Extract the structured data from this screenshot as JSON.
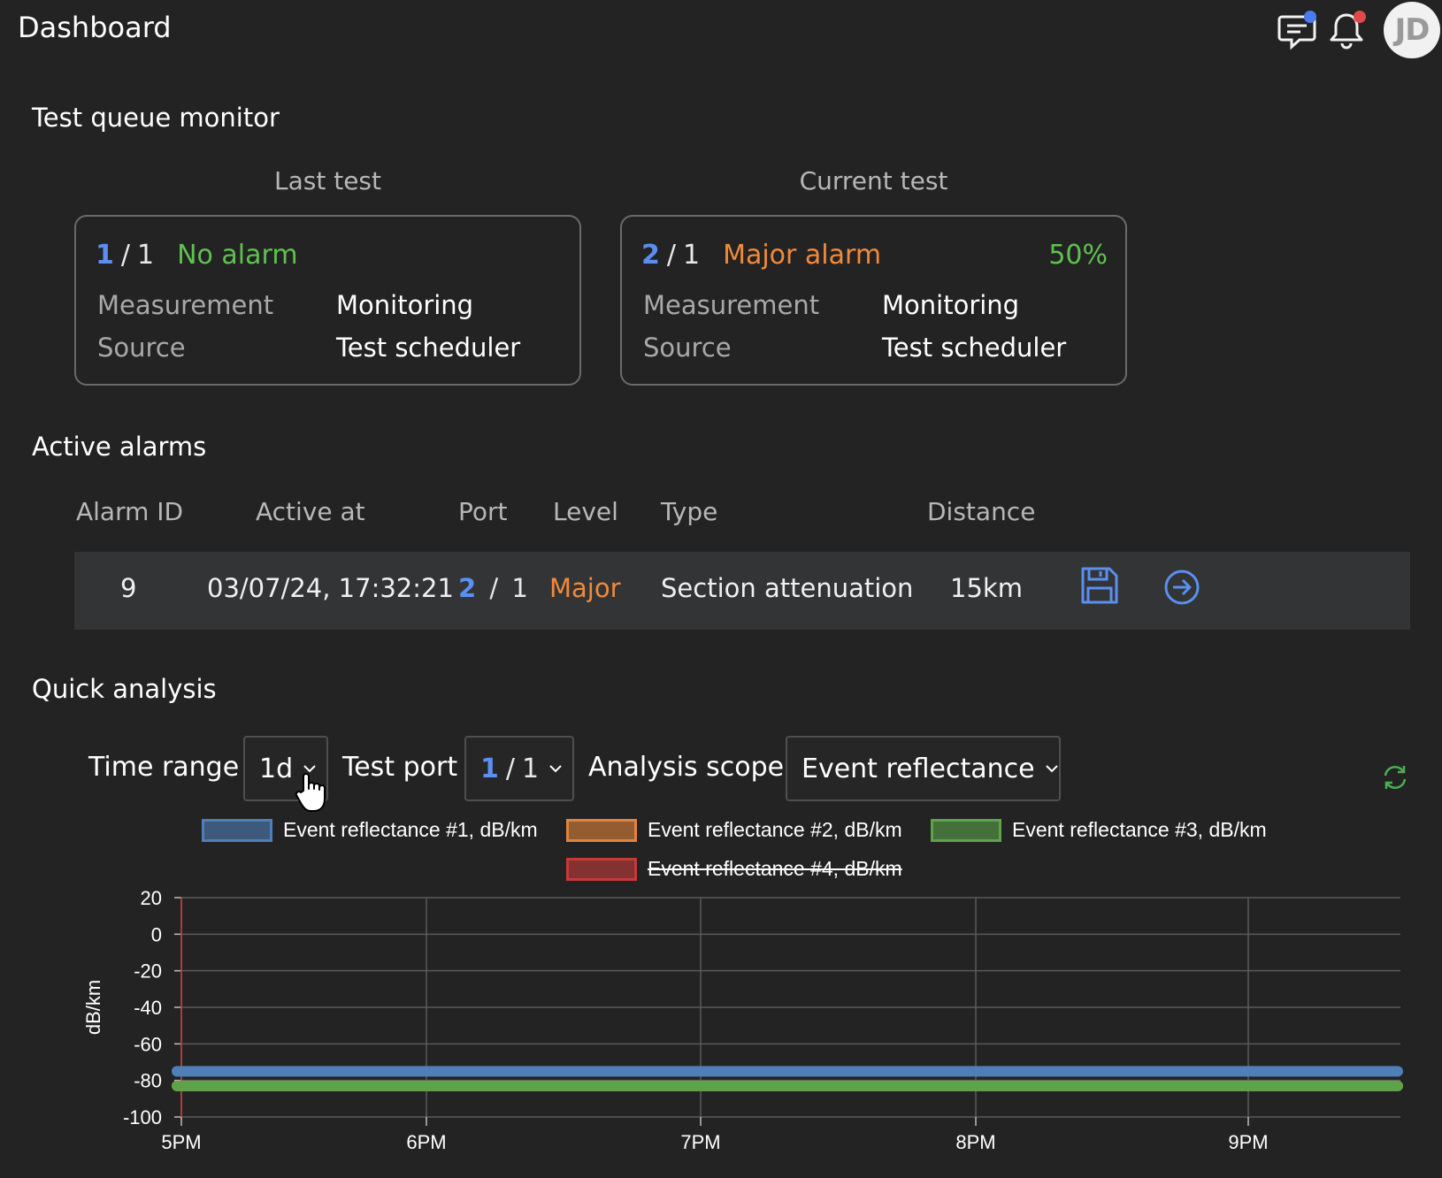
{
  "header": {
    "title": "Dashboard",
    "avatar_initials": "JD",
    "chat_dot_color": "#4a7cf0",
    "bell_dot_color": "#e04a4a"
  },
  "queue": {
    "title": "Test queue monitor",
    "last": {
      "heading": "Last test",
      "port_a": "1",
      "port_b": "1",
      "status": "No alarm",
      "status_color": "#5ec24e",
      "measurement_label": "Measurement",
      "measurement_value": "Monitoring",
      "source_label": "Source",
      "source_value": "Test scheduler"
    },
    "current": {
      "heading": "Current test",
      "port_a": "2",
      "port_b": "1",
      "status": "Major alarm",
      "status_color": "#f08a3c",
      "progress": "50%",
      "measurement_label": "Measurement",
      "measurement_value": "Monitoring",
      "source_label": "Source",
      "source_value": "Test scheduler"
    }
  },
  "alarms": {
    "title": "Active alarms",
    "columns": [
      "Alarm ID",
      "Active at",
      "Port",
      "Level",
      "Type",
      "Distance"
    ],
    "rows": [
      {
        "id": "9",
        "active_at": "03/07/24, 17:32:21",
        "port_a": "2",
        "port_b": "1",
        "level": "Major",
        "type": "Section attenuation",
        "distance": "15km"
      }
    ]
  },
  "analysis": {
    "title": "Quick analysis",
    "time_range_label": "Time range",
    "time_range_value": "1d",
    "test_port_label": "Test port",
    "test_port_a": "1",
    "test_port_b": "1",
    "scope_label": "Analysis scope",
    "scope_value": "Event reflectance"
  },
  "chart_data": {
    "type": "line",
    "ylabel": "dB/km",
    "ylim": [
      -100,
      20
    ],
    "yticks": [
      "20",
      "0",
      "-20",
      "-40",
      "-60",
      "-80",
      "-100"
    ],
    "xticks": [
      "5PM",
      "6PM",
      "7PM",
      "8PM",
      "9PM"
    ],
    "legend_placement": "top",
    "series": [
      {
        "name": "Event reflectance #1, dB/km",
        "color": "#4f7fb8",
        "hidden": false,
        "values": [
          -75,
          -75,
          -75,
          -75,
          -75
        ]
      },
      {
        "name": "Event reflectance #2, dB/km",
        "color": "#e0843a",
        "hidden": false,
        "values": [
          -83,
          -83,
          -83,
          -83,
          -83
        ]
      },
      {
        "name": "Event reflectance #3, dB/km",
        "color": "#5ea34a",
        "hidden": false,
        "values": [
          -83,
          -83,
          -83,
          -83,
          -83
        ]
      },
      {
        "name": "Event reflectance #4, dB/km",
        "color": "#c43a3a",
        "hidden": true,
        "values": []
      }
    ]
  }
}
